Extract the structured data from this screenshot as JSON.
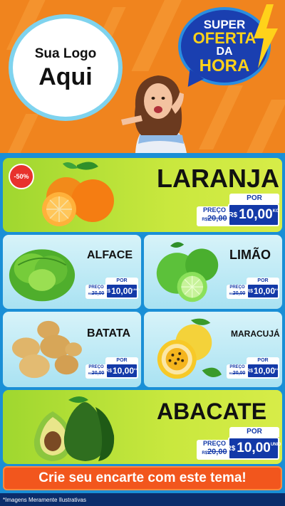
{
  "logo": {
    "line1": "Sua Logo",
    "line2": "Aqui"
  },
  "promo": {
    "super": "SUPER",
    "oferta": "OFERTA",
    "da": "DA",
    "hora": "HORA"
  },
  "discount_badge": "-50%",
  "products": {
    "laranja": {
      "name": "LARANJA",
      "por": "POR",
      "preco_label": "PREÇO",
      "old_price": "20,00",
      "old_prefix": "R$",
      "currency": "R$",
      "price": "10,00",
      "unit": "KG"
    },
    "alface": {
      "name": "ALFACE",
      "por": "POR",
      "preco_label": "PREÇO",
      "old_price": "20,00",
      "old_prefix": "R$",
      "currency": "R$",
      "price": "10,00",
      "unit": "UNID"
    },
    "limao": {
      "name": "LIMÃO",
      "por": "POR",
      "preco_label": "PREÇO",
      "old_price": "20,00",
      "old_prefix": "R$",
      "currency": "R$",
      "price": "10,00",
      "unit": "KG"
    },
    "batata": {
      "name": "BATATA",
      "por": "POR",
      "preco_label": "PREÇO",
      "old_price": "20,00",
      "old_prefix": "R$",
      "currency": "R$",
      "price": "10,00",
      "unit": "KG"
    },
    "maracuja": {
      "name": "MARACUJÁ",
      "por": "POR",
      "preco_label": "PREÇO",
      "old_price": "20,00",
      "old_prefix": "R$",
      "currency": "R$",
      "price": "10,00",
      "unit": "KG"
    },
    "abacate": {
      "name": "ABACATE",
      "por": "POR",
      "preco_label": "PREÇO",
      "old_price": "20,00",
      "old_prefix": "R$",
      "currency": "R$",
      "price": "10,00",
      "unit": "UNID"
    }
  },
  "cta": "Crie seu encarte com este tema!",
  "footer": "*Imagens Meramente Ilustrativas",
  "colors": {
    "orange": "#f0841e",
    "blue": "#1339a8",
    "green": "#b9e13a",
    "cta": "#f2561d"
  }
}
